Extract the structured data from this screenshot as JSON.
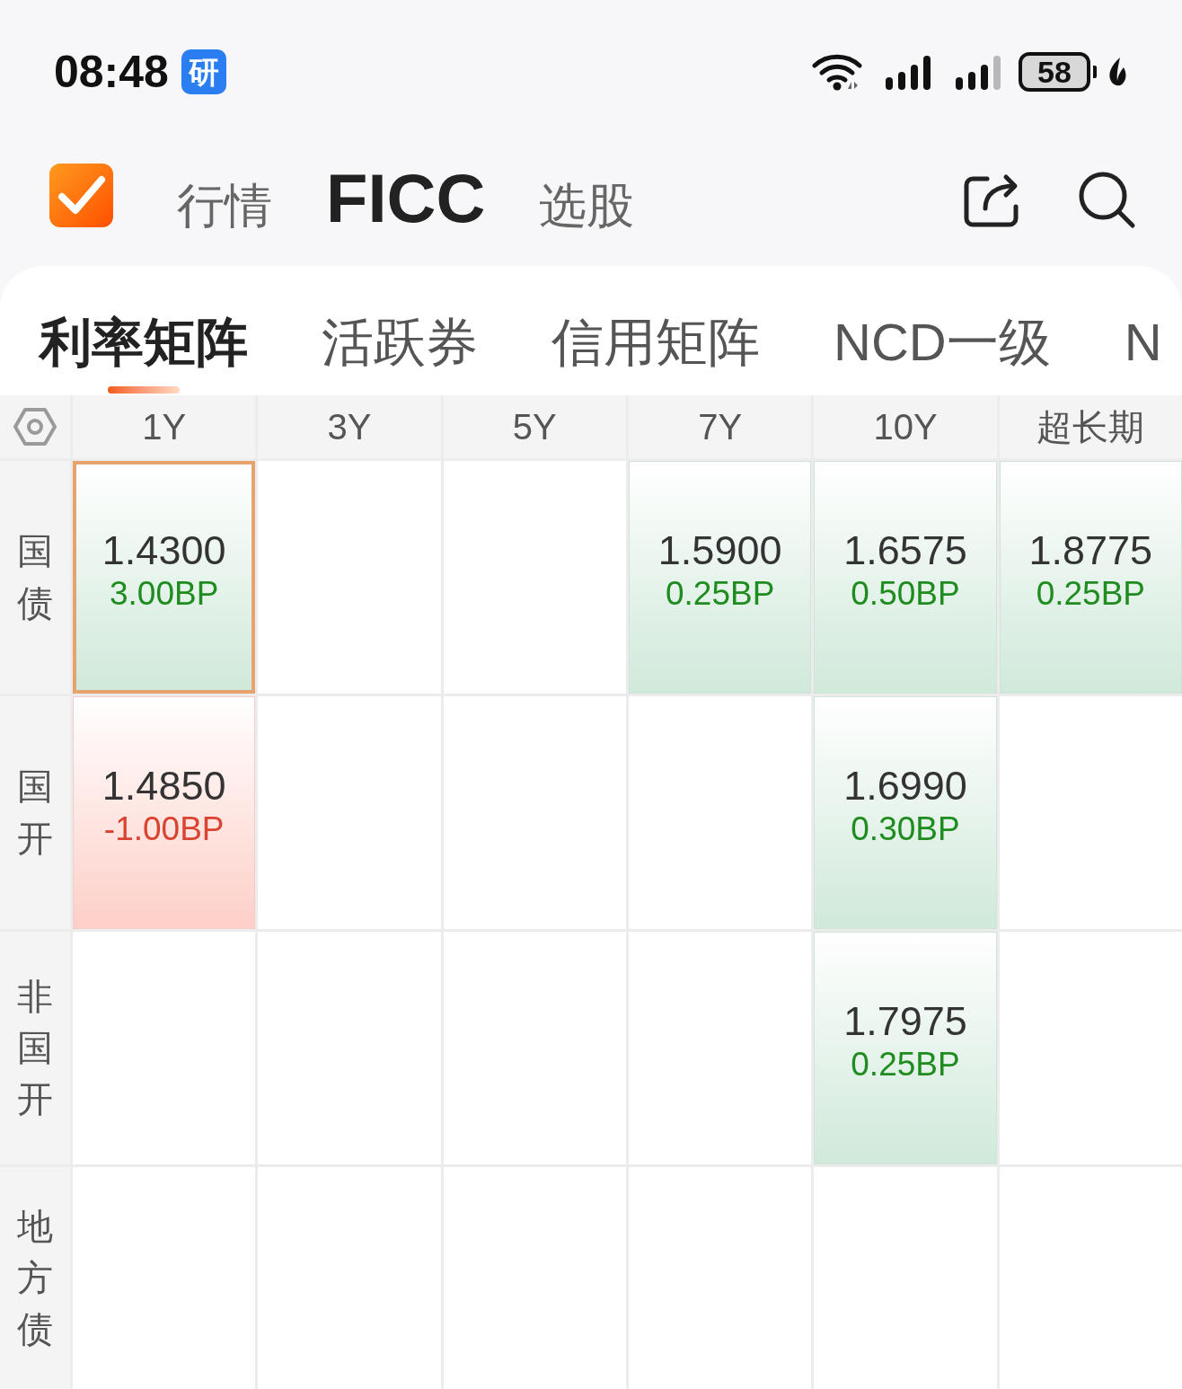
{
  "status_bar": {
    "time": "08:48",
    "badge": "研",
    "battery": "58"
  },
  "header": {
    "nav": [
      {
        "label": "行情",
        "selected": false
      },
      {
        "label": "FICC",
        "selected": true
      },
      {
        "label": "选股",
        "selected": false
      }
    ]
  },
  "tabs": [
    {
      "label": "利率矩阵",
      "selected": true
    },
    {
      "label": "活跃券",
      "selected": false
    },
    {
      "label": "信用矩阵",
      "selected": false
    },
    {
      "label": "NCD一级",
      "selected": false
    },
    {
      "label": "N",
      "selected": false
    }
  ],
  "matrix": {
    "columns": [
      "1Y",
      "3Y",
      "5Y",
      "7Y",
      "10Y",
      "超长期"
    ],
    "rows": [
      {
        "label": "国债",
        "cells": [
          {
            "kind": "quote",
            "rate": "1.4300",
            "change": "3.00BP",
            "falling": false,
            "selected": true
          },
          {
            "kind": "empty",
            "selected": false
          },
          {
            "kind": "empty",
            "selected": false
          },
          {
            "kind": "quote",
            "rate": "1.5900",
            "change": "0.25BP",
            "falling": false,
            "selected": false
          },
          {
            "kind": "quote",
            "rate": "1.6575",
            "change": "0.50BP",
            "falling": false,
            "selected": false
          },
          {
            "kind": "quote",
            "rate": "1.8775",
            "change": "0.25BP",
            "falling": false,
            "selected": false
          }
        ]
      },
      {
        "label": "国开",
        "cells": [
          {
            "kind": "quote",
            "rate": "1.4850",
            "change": "-1.00BP",
            "falling": true,
            "selected": false
          },
          {
            "kind": "empty",
            "selected": false
          },
          {
            "kind": "empty",
            "selected": false
          },
          {
            "kind": "empty",
            "selected": false
          },
          {
            "kind": "quote",
            "rate": "1.6990",
            "change": "0.30BP",
            "falling": false,
            "selected": false
          },
          {
            "kind": "empty",
            "selected": false
          }
        ]
      },
      {
        "label": "非国开",
        "cells": [
          {
            "kind": "empty",
            "selected": false
          },
          {
            "kind": "empty",
            "selected": false
          },
          {
            "kind": "empty",
            "selected": false
          },
          {
            "kind": "empty",
            "selected": false
          },
          {
            "kind": "quote",
            "rate": "1.7975",
            "change": "0.25BP",
            "falling": false,
            "selected": false
          },
          {
            "kind": "empty",
            "selected": false
          }
        ]
      },
      {
        "label": "地方债",
        "cells": [
          {
            "kind": "empty",
            "selected": false
          },
          {
            "kind": "empty",
            "selected": false
          },
          {
            "kind": "empty",
            "selected": false
          },
          {
            "kind": "empty",
            "selected": false
          },
          {
            "kind": "empty",
            "selected": false
          },
          {
            "kind": "empty",
            "selected": false
          }
        ]
      }
    ]
  }
}
